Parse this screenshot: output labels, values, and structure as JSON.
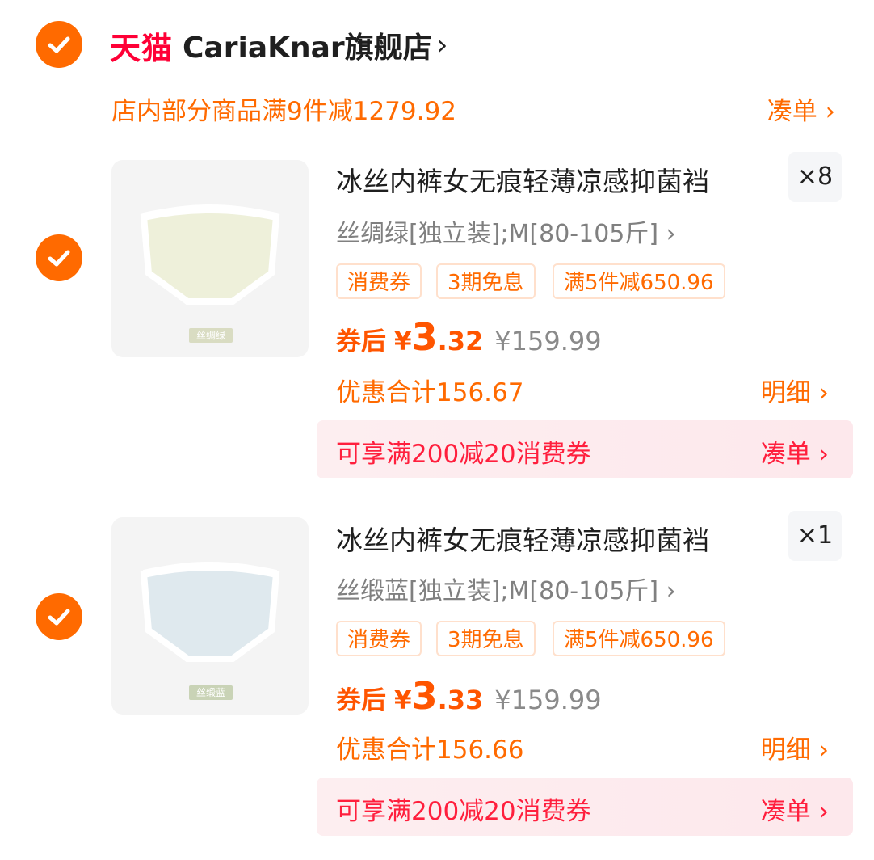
{
  "store": {
    "platform": "天猫",
    "name": "CariaKnar旗舰店",
    "arrow": "›",
    "promo": "店内部分商品满9件减1279.92",
    "promo_link": "凑单 ›"
  },
  "items": [
    {
      "title": "冰丝内裤女无痕轻薄凉感抑菌裆",
      "quantity": "×8",
      "variant": "丝绸绿[独立装];M[80-105斤] ›",
      "image_label": "丝绸绿",
      "tags": [
        "消费券",
        "3期免息",
        "满5件减650.96"
      ],
      "price_label": "券后",
      "currency": "¥",
      "price_int": "3",
      "price_dec": ".32",
      "original_price": "¥159.99",
      "discount_total": "优惠合计156.67",
      "detail_link": "明细 ›",
      "coupon_banner": "可享满200减20消费券",
      "coupon_link": "凑单 ›"
    },
    {
      "title": "冰丝内裤女无痕轻薄凉感抑菌裆",
      "quantity": "×1",
      "variant": "丝缎蓝[独立装];M[80-105斤] ›",
      "image_label": "丝缎蓝",
      "tags": [
        "消费券",
        "3期免息",
        "满5件减650.96"
      ],
      "price_label": "券后",
      "currency": "¥",
      "price_int": "3",
      "price_dec": ".33",
      "original_price": "¥159.99",
      "discount_total": "优惠合计156.66",
      "detail_link": "明细 ›",
      "coupon_banner": "可享满200减20消费券",
      "coupon_link": "凑单 ›"
    }
  ],
  "colors": {
    "accent": "#ff6a00",
    "tmall_red": "#ff0036",
    "banner_red": "#ff1f3d",
    "item1_fabric": "#eef0da",
    "item2_fabric": "#dfe9ee"
  },
  "icons": {
    "select": "check-circle-icon"
  }
}
